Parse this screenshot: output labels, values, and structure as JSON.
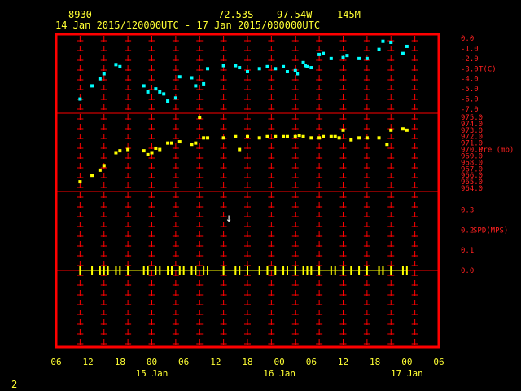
{
  "header": {
    "station_id": "8930",
    "latitude": "72.53S",
    "longitude": "97.54W",
    "elevation": "145M",
    "time_range": "14 Jan 2015/120000UTC - 17 Jan 2015/000000UTC"
  },
  "footer": {
    "page_number": "2"
  },
  "wind_arrow": "↓",
  "colors": {
    "frame": "#ff0000",
    "temperature": "#00ffff",
    "pressure": "#ffff00",
    "wind_marks": "#ffff00",
    "labels": "#ffff33"
  },
  "chart_data": [
    {
      "type": "scatter",
      "label": "T(C)",
      "ylim": [
        -7.0,
        0.0
      ],
      "y_ticks": [
        "0.0",
        "-1.0",
        "-2.0",
        "-3.0",
        "-4.0",
        "-5.0",
        "-6.0",
        "-7.0"
      ],
      "x_hours": [
        12,
        15,
        17,
        18,
        21,
        22,
        28,
        29,
        31,
        32,
        33,
        34,
        36,
        37,
        40,
        41,
        43,
        44,
        48,
        51,
        52,
        54,
        57,
        59,
        61,
        63,
        64,
        66,
        66.5,
        68,
        68.5,
        69,
        70,
        72,
        73,
        75,
        78,
        79,
        82,
        84,
        87,
        88,
        90,
        93,
        94
      ],
      "values": [
        -6.0,
        -4.7,
        -4.0,
        -3.5,
        -2.6,
        -2.8,
        -4.7,
        -5.3,
        -5.0,
        -5.3,
        -5.5,
        -6.2,
        -5.9,
        -3.8,
        -3.9,
        -4.7,
        -4.5,
        -3.0,
        -2.7,
        -2.7,
        -2.9,
        -3.3,
        -3.0,
        -2.8,
        -3.0,
        -2.8,
        -3.3,
        -3.2,
        -3.5,
        -2.4,
        -2.7,
        -2.8,
        -2.9,
        -1.6,
        -1.5,
        -2.0,
        -1.9,
        -1.7,
        -2.0,
        -2.0,
        -1.1,
        -0.3,
        -0.4,
        -1.5,
        -0.8
      ]
    },
    {
      "type": "scatter",
      "label": "Pre (mb)",
      "ylim": [
        964.0,
        975.0
      ],
      "y_ticks": [
        "975.0",
        "974.0",
        "973.0",
        "972.0",
        "971.0",
        "970.0",
        "969.0",
        "968.0",
        "967.0",
        "966.0",
        "965.0",
        "964.0"
      ],
      "x_hours": [
        12,
        15,
        17,
        18,
        21,
        22,
        24,
        28,
        29,
        30,
        31,
        32,
        34,
        35,
        37,
        40,
        41,
        42,
        43,
        44,
        48,
        51,
        52,
        54,
        57,
        59,
        61,
        63,
        64,
        66,
        67,
        68,
        70,
        72,
        73,
        75,
        76,
        77,
        78,
        80,
        82,
        84,
        87,
        89,
        90,
        93,
        94
      ],
      "values": [
        965.0,
        966.0,
        966.8,
        967.5,
        969.5,
        969.8,
        970.0,
        969.8,
        969.2,
        969.5,
        970.2,
        970.0,
        971.0,
        971.0,
        971.2,
        970.8,
        971.0,
        975.0,
        971.8,
        971.8,
        971.8,
        972.0,
        970.0,
        972.0,
        971.8,
        972.0,
        972.0,
        972.0,
        972.0,
        972.0,
        972.2,
        972.0,
        971.8,
        971.8,
        972.0,
        972.0,
        972.0,
        971.8,
        973.0,
        971.5,
        971.8,
        971.8,
        971.8,
        970.8,
        973.0,
        973.2,
        973.0
      ]
    },
    {
      "type": "line",
      "label": "SPD(MPS)",
      "ylim": [
        0.0,
        0.35
      ],
      "y_ticks": [
        "0.3",
        "0.2",
        "0.1",
        "0.0"
      ],
      "obs_hours": [
        12,
        15,
        17,
        18,
        19,
        21,
        22,
        24,
        28,
        29,
        31,
        32,
        34,
        35,
        37,
        38,
        40,
        41,
        43,
        44,
        48,
        51,
        52,
        54,
        57,
        59,
        61,
        63,
        64,
        66,
        68,
        69,
        70,
        72,
        75,
        76,
        78,
        80,
        82,
        84,
        87,
        88,
        90,
        93,
        94
      ],
      "values": [
        0.0,
        0.0,
        0.0,
        0.0,
        0.0,
        0.0,
        0.0,
        0.0,
        0.0,
        0.0,
        0.0,
        0.0,
        0.0,
        0.0,
        0.0,
        0.0,
        0.0,
        0.0,
        0.0,
        0.0,
        0.0,
        0.0,
        0.0,
        0.0,
        0.0,
        0.0,
        0.0,
        0.0,
        0.0,
        0.0,
        0.0,
        0.0,
        0.0,
        0.0,
        0.0,
        0.0,
        0.0,
        0.0,
        0.0,
        0.0,
        0.0,
        0.0,
        0.0,
        0.0,
        0.0
      ]
    }
  ],
  "x_axis": {
    "range_hours": [
      6,
      102
    ],
    "tick_hours": [
      6,
      12,
      18,
      24,
      30,
      36,
      42,
      48,
      54,
      60,
      66,
      72,
      78,
      84,
      90,
      96,
      102
    ],
    "tick_labels": [
      "06",
      "12",
      "18",
      "00",
      "06",
      "12",
      "18",
      "00",
      "06",
      "12",
      "18",
      "00",
      "06"
    ],
    "tick_label_hours": [
      6,
      12,
      18,
      24,
      30,
      36,
      42,
      48,
      54,
      60,
      66,
      72,
      78,
      84,
      90,
      96,
      102
    ],
    "day_labels": [
      {
        "text": "15 Jan",
        "hour": 24
      },
      {
        "text": "16 Jan",
        "hour": 48
      },
      {
        "text": "17 Jan",
        "hour": 72
      }
    ]
  }
}
